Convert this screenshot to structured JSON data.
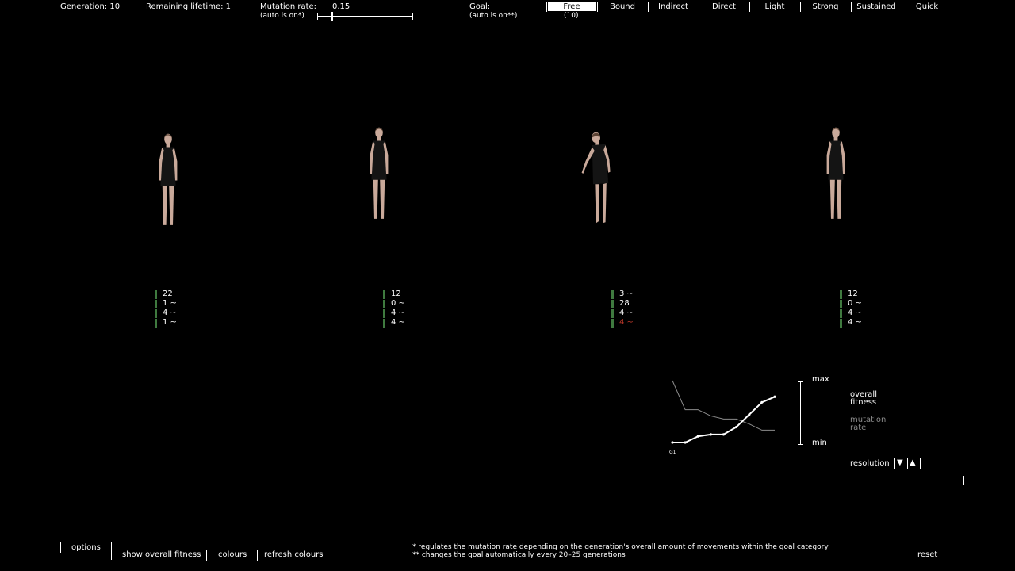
{
  "header": {
    "generation_label": "Generation: 10",
    "lifetime_label": "Remaining lifetime: 1",
    "mutation_label": "Mutation rate:",
    "mutation_value": "0.15",
    "mutation_auto": "(auto is on*)",
    "mutation_slider_fraction": 0.15,
    "goal_label": "Goal:",
    "goal_auto": "(auto is on**)",
    "goal_count": "(10)",
    "goals": [
      "Free",
      "Bound",
      "Indirect",
      "Direct",
      "Light",
      "Strong",
      "Sustained",
      "Quick"
    ],
    "active_goal": "Free"
  },
  "individuals": [
    {
      "stats": [
        "22",
        "1 ~",
        "4 ~",
        "1 ~"
      ],
      "warn_index": -1
    },
    {
      "stats": [
        "12",
        "0 ~",
        "4 ~",
        "4 ~"
      ],
      "warn_index": -1
    },
    {
      "stats": [
        "3 ~",
        "28",
        "4 ~",
        "4 ~"
      ],
      "warn_index": 3
    },
    {
      "stats": [
        "12",
        "0 ~",
        "4 ~",
        "4 ~"
      ],
      "warn_index": -1
    }
  ],
  "graph": {
    "start_label": "G1",
    "max_label": "max",
    "min_label": "min",
    "fitness_label_1": "overall",
    "fitness_label_2": "fitness",
    "mutation_label_1": "mutation",
    "mutation_label_2": "rate",
    "resolution_label": "resolution",
    "res_down": "▼",
    "res_up": "▲",
    "fitness_series": [
      0.0,
      0.0,
      0.1,
      0.13,
      0.13,
      0.25,
      0.45,
      0.65,
      0.74
    ],
    "mutation_series": [
      1.0,
      0.53,
      0.53,
      0.43,
      0.38,
      0.38,
      0.3,
      0.2,
      0.2
    ],
    "fitness_color": "#ffffff",
    "mutation_color": "#8c8c8c"
  },
  "footer": {
    "options": "options",
    "show_fitness": "show overall fitness",
    "colours": "colours",
    "refresh": "refresh colours",
    "note1": "* regulates the mutation rate depending on the generation's overall amount of movements within the goal category",
    "note2": "** changes the goal automatically every 20–25 generations",
    "reset": "reset"
  },
  "colors": {
    "stat_bar": "#3f7a3f",
    "warn": "#c0392b",
    "background": "#000000"
  }
}
